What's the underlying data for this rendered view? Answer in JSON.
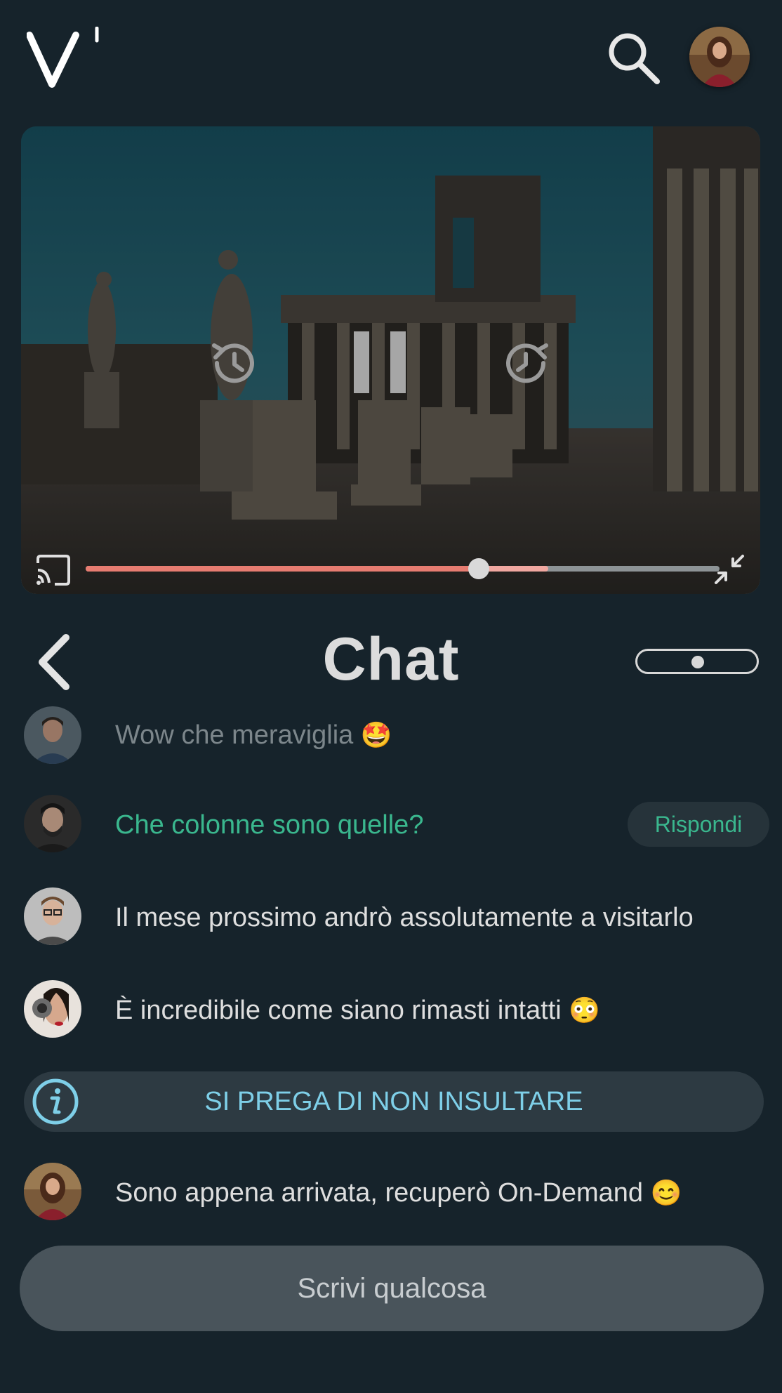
{
  "header": {
    "logo_icon": "logo-icon",
    "search_icon": "search-icon",
    "avatar_icon": "user-avatar"
  },
  "player": {
    "state": "playing",
    "progress": 0.62,
    "buffered": 0.73,
    "controls": {
      "rewind_icon": "rewind-icon",
      "pause_icon": "pause-icon",
      "forward_icon": "forward-icon",
      "cast_icon": "cast-icon",
      "minimize_icon": "minimize-icon"
    },
    "colors": {
      "played": "#e77c71",
      "buffer": "#f0a7a0",
      "track": "#8d9396"
    }
  },
  "chat": {
    "title": "Chat",
    "back_icon": "chevron-left-icon",
    "messages": [
      {
        "text": "Wow che meraviglia",
        "emoji": "🤩",
        "style": "faded"
      },
      {
        "text": "Che colonne sono quelle?",
        "emoji": "",
        "style": "highlight",
        "action": "Rispondi"
      },
      {
        "text": "Il mese prossimo andrò assolutamente a visitarlo",
        "emoji": "",
        "style": "normal"
      },
      {
        "text": "È incredibile come siano rimasti intatti",
        "emoji": "😳",
        "style": "normal"
      },
      {
        "text": "Sono appena arrivata, recuperò On-Demand",
        "emoji": "😊",
        "style": "normal"
      }
    ],
    "notice": {
      "text": "SI PREGA DI NON INSULTARE",
      "icon": "info-icon"
    },
    "composer": {
      "placeholder": "Scrivi qualcosa",
      "value": ""
    }
  },
  "colors": {
    "background": "#16232b",
    "accent_green": "#3ab78e",
    "notice_blue": "#7ecfe8"
  }
}
